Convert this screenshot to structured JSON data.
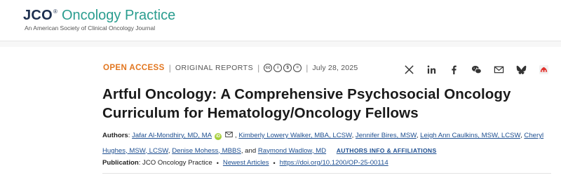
{
  "header": {
    "logo_abbrev": "JCO",
    "logo_reg": "®",
    "logo_name": "Oncology Practice",
    "tagline": "An American Society of Clinical Oncology Journal"
  },
  "meta": {
    "access": "OPEN ACCESS",
    "separator": "|",
    "report_type": "ORIGINAL REPORTS",
    "license_icons": [
      "cc-icon",
      "by-icon",
      "nc-icon",
      "nd-icon"
    ],
    "license_glyphs": [
      "cc",
      "i",
      "$",
      "="
    ],
    "date": "July 28, 2025"
  },
  "share": [
    "x-icon",
    "linkedin-icon",
    "facebook-icon",
    "wechat-icon",
    "email-icon",
    "bluesky-icon",
    "mendeley-icon"
  ],
  "article": {
    "title": "Artful Oncology: A Comprehensive Psychosocial Oncology Curriculum for Hematology/Oncology Fellows"
  },
  "authors": {
    "label": "Authors",
    "list": [
      "Jafar Al-Mondhiry, MD, MA",
      "Kimberly Lowery Walker, MBA, LCSW",
      "Jennifer Bires, MSW",
      "Leigh Ann Caulkins, MSW, LCSW",
      "Cheryl Hughes, MSW, LCSW",
      "Denise Mohess, MBBS",
      "Raymond Wadlow, MD"
    ],
    "orcid": "iD",
    "and": "and",
    "affiliations_link": "AUTHORS INFO & AFFILIATIONS"
  },
  "publication": {
    "label": "Publication",
    "journal": "JCO Oncology Practice",
    "section": "Newest Articles",
    "doi": "https://doi.org/10.1200/OP-25-00114",
    "bullet": "•"
  },
  "colors": {
    "brand_navy": "#1d2f4f",
    "brand_teal": "#2a9d8f",
    "open_access": "#e2761f",
    "link": "#1e4f91",
    "orcid": "#a6ce39"
  }
}
